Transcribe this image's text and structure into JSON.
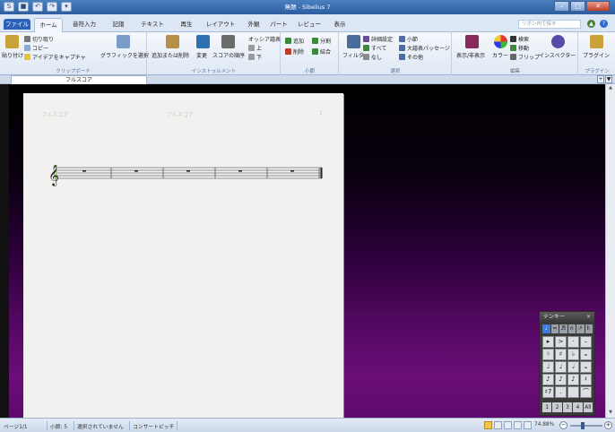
{
  "window": {
    "title": "無題 - Sibelius 7"
  },
  "quick_access": [
    "S",
    "■",
    "↶",
    "↷",
    "▾"
  ],
  "window_controls": {
    "minimize": "–",
    "maximize": "□",
    "close": "✕"
  },
  "tabs": [
    {
      "label": "ファイル",
      "style": "file"
    },
    {
      "label": "ホーム",
      "style": "active"
    },
    {
      "label": "音符入力"
    },
    {
      "label": "記譜"
    },
    {
      "label": "テキスト"
    },
    {
      "label": "再生"
    },
    {
      "label": "レイアウト"
    },
    {
      "label": "外観"
    },
    {
      "label": "パート"
    },
    {
      "label": "レビュー"
    },
    {
      "label": "表示"
    }
  ],
  "ribbon_search": {
    "placeholder": "リボン内で探す"
  },
  "ribbon": {
    "clipboard": {
      "paste": "貼り付け",
      "cut": "切り取り",
      "copy": "コピー",
      "capture": "アイデアをキャプチャ",
      "select_graphic": "グラフィックを選択",
      "label": "クリップボード"
    },
    "instruments": {
      "add_remove": "追加または削除",
      "change": "変更",
      "score_order": "スコアの順序",
      "ossia": "オッシア譜表",
      "up": "上",
      "down": "下",
      "label": "インストゥルメント"
    },
    "bars": {
      "add": "追加",
      "split": "分割",
      "delete": "削除",
      "join": "結合",
      "label": "小節"
    },
    "selection": {
      "filter": "フィルタ",
      "advanced": "詳細設定",
      "all": "すべて",
      "none": "なし",
      "bar": "小節",
      "large_passage": "大譜表パッセージ",
      "other": "その他",
      "label": "選択"
    },
    "edit": {
      "show_hide": "表示/非表示",
      "color": "カラー",
      "find": "検索",
      "move": "移動",
      "flip": "フリップ",
      "inspector": "インスペクター",
      "label": "編集"
    },
    "plugins": {
      "label": "プラグイン",
      "group_label": "プラグイン"
    }
  },
  "document_tab": {
    "label": "フルスコア"
  },
  "zoom_buttons": [
    "+",
    "▼"
  ],
  "page": {
    "header_left": "フルスコア",
    "header_center": "フルスコア",
    "page_number": "1"
  },
  "keypad": {
    "title": "テンキー",
    "tabs": [
      "♩",
      "═",
      "♬",
      "∩",
      "↗",
      "𝄆"
    ],
    "keys": [
      "▸",
      ">",
      "·",
      "–",
      "♮",
      "♯",
      "♭",
      "𝄪",
      "♩",
      "♩",
      "𝅗𝅥",
      "𝅝",
      "♪",
      "♪",
      "♪",
      "𝄽",
      "♯7",
      ".",
      "",
      "⌒"
    ],
    "layers": [
      "1",
      "2",
      "3",
      "4",
      "All"
    ]
  },
  "status": {
    "page": "ページ1/1",
    "bar": "小節: 5",
    "selection": "選択されていません",
    "pitch": "コンサートピッチ",
    "zoom": "74.88%"
  },
  "colors": {
    "accent": "#2c62b8",
    "purple_bg": "#6b0e78"
  }
}
